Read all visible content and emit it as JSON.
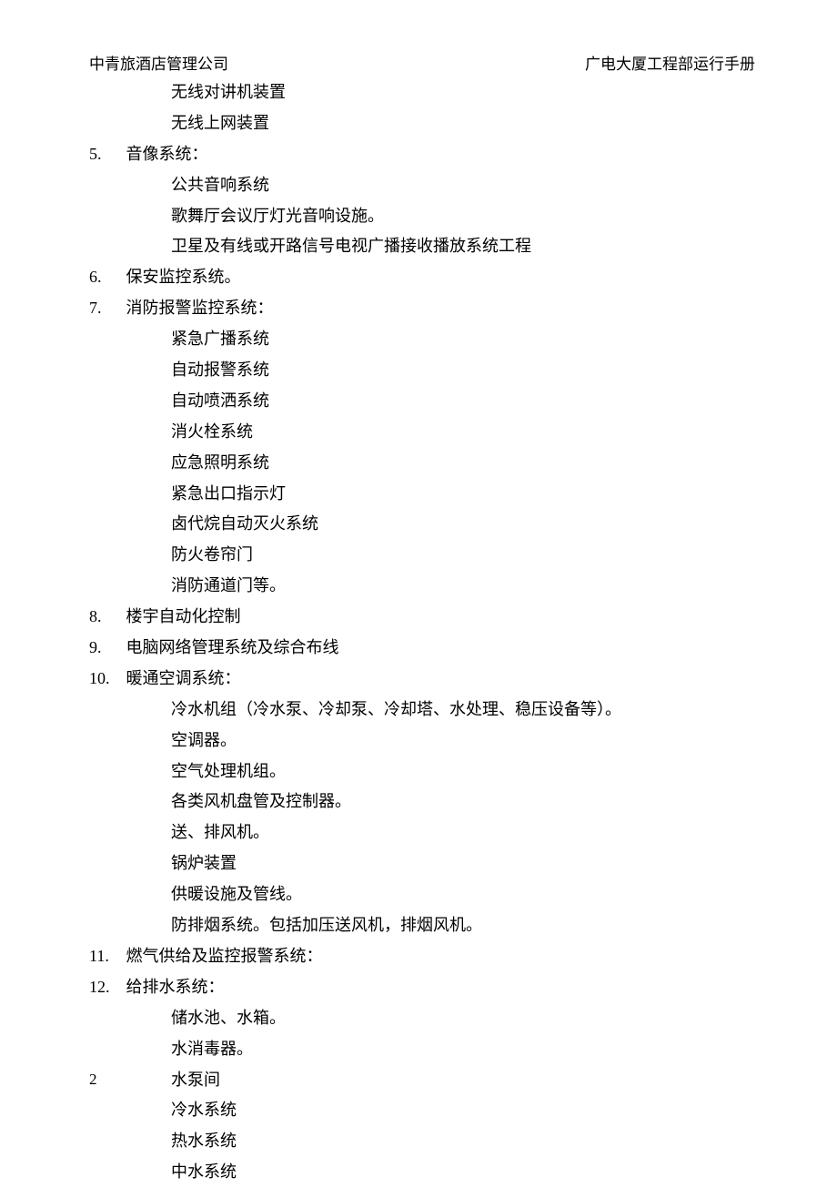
{
  "header": {
    "left": "中青旅酒店管理公司",
    "right": "广电大厦工程部运行手册"
  },
  "pre_items": [
    "无线对讲机装置",
    "无线上网装置"
  ],
  "sections": [
    {
      "num": "5.",
      "label": "音像系统：",
      "subs": [
        "公共音响系统",
        "歌舞厅会议厅灯光音响设施。",
        "卫星及有线或开路信号电视广播接收播放系统工程"
      ]
    },
    {
      "num": "6.",
      "label": "保安监控系统。",
      "subs": []
    },
    {
      "num": "7.",
      "label": "消防报警监控系统：",
      "subs": [
        "紧急广播系统",
        "自动报警系统",
        "自动喷洒系统",
        "消火栓系统",
        "应急照明系统",
        "紧急出口指示灯",
        "卤代烷自动灭火系统",
        "防火卷帘门",
        "消防通道门等。"
      ]
    },
    {
      "num": "8.",
      "label": "楼宇自动化控制",
      "subs": []
    },
    {
      "num": "9.",
      "label": "电脑网络管理系统及综合布线",
      "subs": []
    },
    {
      "num": "10.",
      "label": "暖通空调系统：",
      "subs": [
        "冷水机组（冷水泵、冷却泵、冷却塔、水处理、稳压设备等）。",
        "空调器。",
        "空气处理机组。",
        "各类风机盘管及控制器。",
        "送、排风机。",
        "锅炉装置",
        "供暖设施及管线。",
        "防排烟系统。包括加压送风机，排烟风机。"
      ]
    },
    {
      "num": "11.",
      "label": "燃气供给及监控报警系统：",
      "subs": []
    },
    {
      "num": "12.",
      "label": "给排水系统：",
      "subs": [
        "储水池、水箱。",
        "水消毒器。",
        "水泵间",
        "冷水系统",
        "热水系统",
        "中水系统"
      ]
    }
  ],
  "page_number": "2"
}
